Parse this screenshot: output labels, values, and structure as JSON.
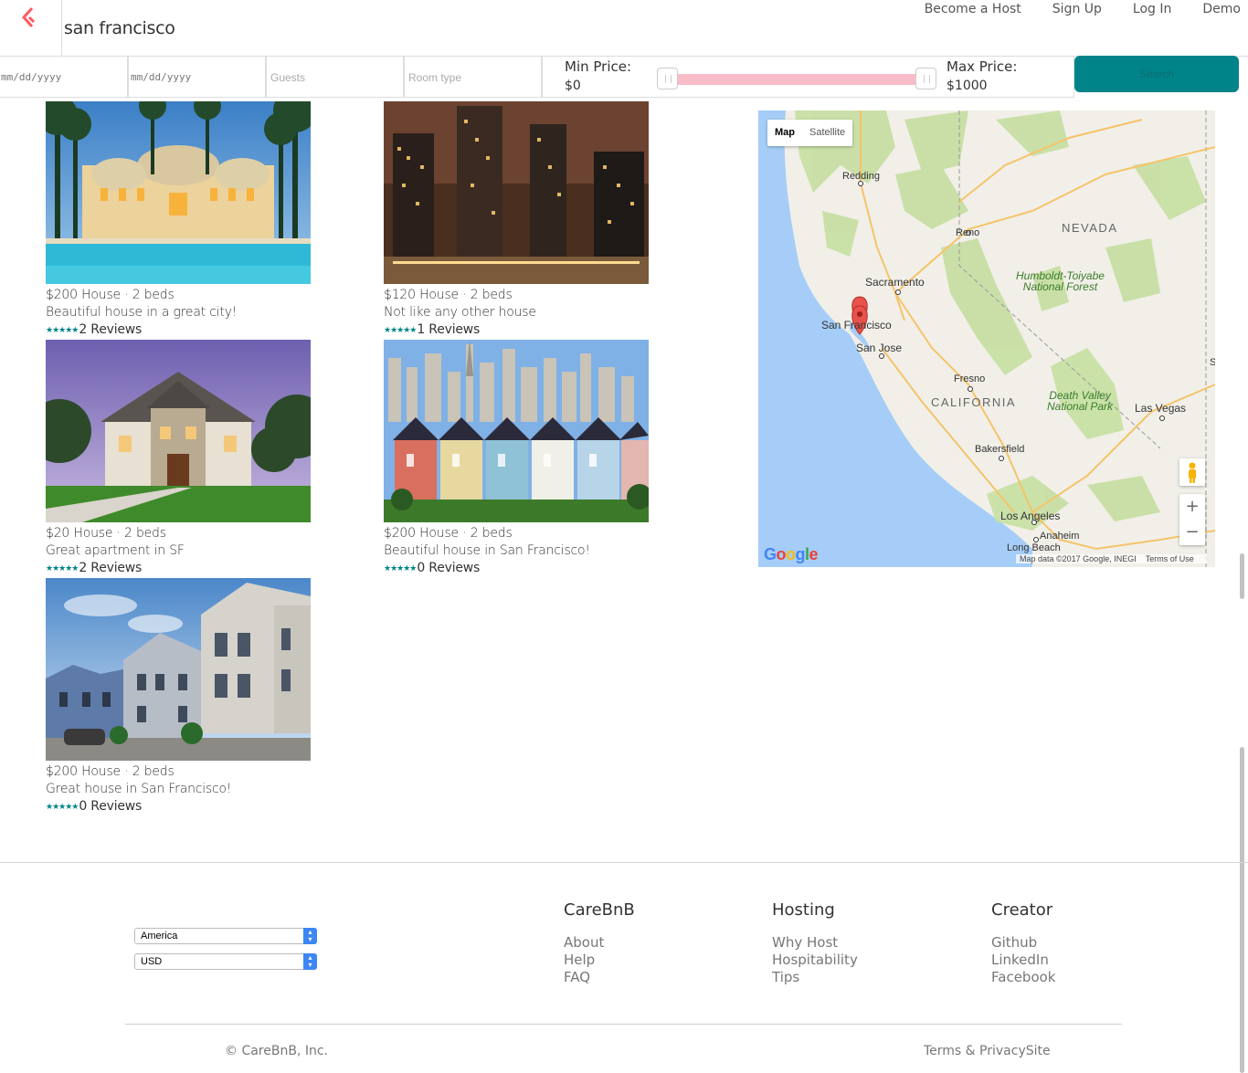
{
  "header": {
    "search_query": "san francisco",
    "nav": [
      "Become a Host",
      "Sign Up",
      "Log In",
      "Demo"
    ]
  },
  "filters": {
    "checkin_placeholder": "mm/dd/yyyy",
    "checkout_placeholder": "mm/dd/yyyy",
    "guests_placeholder": "Guests",
    "room_type_placeholder": "Room type",
    "min_price_label": "Min Price:",
    "min_price_value": "$0",
    "max_price_label": "Max Price:",
    "max_price_value": "$1000",
    "price_range_fraction": [
      0.0,
      1.0
    ],
    "search_label": "Search"
  },
  "listings": [
    {
      "line1": "$200 House · 2 beds",
      "line2": "Beautiful house in a great city!",
      "stars": "★★★★★",
      "reviews": "2 Reviews",
      "photo": "resort-pool-photo"
    },
    {
      "line1": "$120 House · 2 beds",
      "line2": "Not like any other house",
      "stars": "★★★★★",
      "reviews": "1 Reviews",
      "photo": "city-night-skyline-photo"
    },
    {
      "line1": "$20 House · 2 beds",
      "line2": "Great apartment in SF",
      "stars": "★★★★★",
      "reviews": "2 Reviews",
      "photo": "stone-house-photo"
    },
    {
      "line1": "$200 House · 2 beds",
      "line2": "Beautiful house in San Francisco!",
      "stars": "★★★★★",
      "reviews": "0 Reviews",
      "photo": "painted-ladies-photo"
    },
    {
      "line1": "$200 House · 2 beds",
      "line2": "Great house in San Francisco!",
      "stars": "★★★★★",
      "reviews": "0 Reviews",
      "photo": "victorian-houses-photo"
    }
  ],
  "map": {
    "toggle": [
      "Map",
      "Satellite"
    ],
    "labels": {
      "redding": "Redding",
      "reno": "Reno",
      "nevada": "NEVADA",
      "sacramento": "Sacramento",
      "humboldt": "Humboldt-Toiyabe",
      "humboldt2": "National Forest",
      "san_francisco": "San Francisco",
      "san_jose": "San Jose",
      "fresno": "Fresno",
      "california": "CALIFORNIA",
      "death_valley": "Death Valley",
      "death_valley2": "National Park",
      "las_vegas": "Las Vegas",
      "bakersfield": "Bakersfield",
      "los_angeles": "Los Angeles",
      "anaheim": "Anaheim",
      "long_beach": "Long Beach",
      "edge_s": "S"
    },
    "zoom_in": "+",
    "zoom_out": "−",
    "google": "Google",
    "attribution": "Map data ©2017 Google, INEGI",
    "terms": "Terms of Use"
  },
  "footer": {
    "country": "America",
    "currency": "USD",
    "columns": [
      {
        "title": "CareBnB",
        "links": [
          "About",
          "Help",
          "FAQ"
        ]
      },
      {
        "title": "Hosting",
        "links": [
          "Why Host",
          "Hospitability",
          "Tips"
        ]
      },
      {
        "title": "Creator",
        "links": [
          "Github",
          "LinkedIn",
          "Facebook"
        ]
      }
    ],
    "copyright": "© CareBnB, Inc.",
    "terms": "Terms & PrivacySite"
  },
  "colors": {
    "accent": "#008489",
    "brand": "#FF5A5F",
    "slider": "#f8bcc8"
  }
}
